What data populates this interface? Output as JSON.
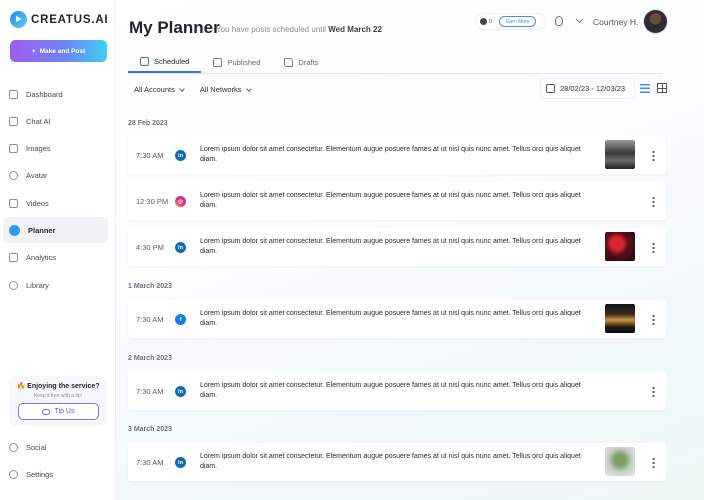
{
  "brand": {
    "name": "CREATUS.AI"
  },
  "sidebar": {
    "make_button": "Make and Post",
    "items": [
      {
        "label": "Dashboard",
        "icon": "dashboard-icon"
      },
      {
        "label": "Chat AI",
        "icon": "chat-icon"
      },
      {
        "label": "Images",
        "icon": "image-icon"
      },
      {
        "label": "Avatar",
        "icon": "avatar-icon"
      },
      {
        "label": "Videos",
        "icon": "video-icon"
      },
      {
        "label": "Planner",
        "icon": "planner-icon",
        "active": true
      },
      {
        "label": "Analytics",
        "icon": "analytics-icon"
      },
      {
        "label": "Library",
        "icon": "library-icon"
      }
    ],
    "promo": {
      "title": "🔥 Enjoying the service?",
      "subtitle": "Keep it free with a tip!",
      "button": "Tip Us"
    },
    "bottom_items": [
      {
        "label": "Social",
        "icon": "social-icon"
      },
      {
        "label": "Settings",
        "icon": "settings-icon"
      }
    ]
  },
  "header": {
    "title": "My Planner",
    "subtitle_prefix": "You have posts scheduled until",
    "subtitle_date": "Wed March 22",
    "coins": "0",
    "earn_button": "Earn More",
    "user_name": "Courtney H."
  },
  "tabs": [
    {
      "label": "Scheduled",
      "active": true
    },
    {
      "label": "Published",
      "active": false
    },
    {
      "label": "Drafts",
      "active": false
    }
  ],
  "filters": {
    "accounts": "All Accounts",
    "networks": "All Networks",
    "date_range": "28/02/23 - 12/03/23"
  },
  "groups": [
    {
      "date": "28 Feb 2023",
      "posts": [
        {
          "time": "7:30 AM",
          "network": "linkedin",
          "network_glyph": "in",
          "text": "Lorem ipsum dolor sit amet consectetur. Elementum augue posuere fames at ut nisl quis nunc amet. Tellus orci quis aliquet diam.",
          "thumb": "t1"
        },
        {
          "time": "12:30 PM",
          "network": "instagram",
          "network_glyph": "◎",
          "text": "Lorem ipsum dolor sit amet consectetur. Elementum augue posuere fames at ut nisl quis nunc amet. Tellus orci quis aliquet diam.",
          "thumb": ""
        },
        {
          "time": "4:30 PM",
          "network": "linkedin",
          "network_glyph": "in",
          "text": "Lorem ipsum dolor sit amet consectetur. Elementum augue posuere fames at ut nisl quis nunc amet. Tellus orci quis aliquet diam.",
          "thumb": "t3"
        }
      ]
    },
    {
      "date": "1 March 2023",
      "posts": [
        {
          "time": "7:30 AM",
          "network": "facebook",
          "network_glyph": "f",
          "text": "Lorem ipsum dolor sit amet consectetur. Elementum augue posuere fames at ut nisl quis nunc amet. Tellus orci quis aliquet diam.",
          "thumb": "t4"
        }
      ]
    },
    {
      "date": "2 March 2023",
      "posts": [
        {
          "time": "7:30 AM",
          "network": "linkedin",
          "network_glyph": "in",
          "text": "Lorem ipsum dolor sit amet consectetur. Elementum augue posuere fames at ut nisl quis nunc amet. Tellus orci quis aliquet diam.",
          "thumb": ""
        }
      ]
    },
    {
      "date": "3 March 2023",
      "posts": [
        {
          "time": "7:30 AM",
          "network": "linkedin",
          "network_glyph": "in",
          "text": "Lorem ipsum dolor sit amet consectetur. Elementum augue posuere fames at ut nisl quis nunc amet. Tellus orci quis aliquet diam.",
          "thumb": "t6"
        }
      ]
    }
  ]
}
